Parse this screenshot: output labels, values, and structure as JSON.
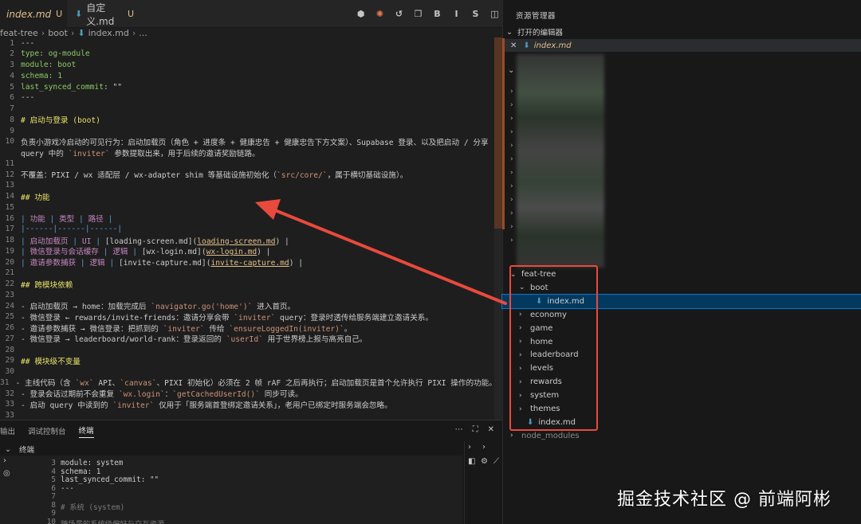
{
  "tabs": [
    {
      "label": "index.md",
      "status": "U"
    },
    {
      "label": "自定义.md",
      "status": "U"
    }
  ],
  "breadcrumb": [
    "feat-tree",
    "boot",
    "index.md",
    "..."
  ],
  "editor_lines": [
    {
      "n": "1",
      "segs": [
        {
          "t": "---",
          "c": "v"
        }
      ]
    },
    {
      "n": "2",
      "segs": [
        {
          "t": "type",
          "c": "yk"
        },
        {
          "t": ": og-module",
          "c": "yk"
        }
      ]
    },
    {
      "n": "3",
      "segs": [
        {
          "t": "module",
          "c": "yk"
        },
        {
          "t": ": boot",
          "c": "yk"
        }
      ]
    },
    {
      "n": "4",
      "segs": [
        {
          "t": "schema",
          "c": "yk"
        },
        {
          "t": ": 1",
          "c": "yk"
        }
      ]
    },
    {
      "n": "5",
      "segs": [
        {
          "t": "last_synced_commit",
          "c": "yk"
        },
        {
          "t": ": \"\"",
          "c": "v"
        }
      ]
    },
    {
      "n": "6",
      "segs": [
        {
          "t": "---",
          "c": "v"
        }
      ]
    },
    {
      "n": "7",
      "segs": []
    },
    {
      "n": "8",
      "segs": [
        {
          "t": "# 启动与登录 (boot)",
          "c": "hd"
        }
      ]
    },
    {
      "n": "9",
      "segs": []
    },
    {
      "n": "10",
      "segs": [
        {
          "t": "负责小游戏冷启动的可见行为：启动加载页（角色 + 进度条 + 健康忠告 + 健康忠告下方文案）、Supabase 登录、以及把启动 / 分享",
          "c": "v"
        }
      ]
    },
    {
      "n": "",
      "segs": [
        {
          "t": "query 中的 ",
          "c": "v"
        },
        {
          "t": "`inviter`",
          "c": "tick"
        },
        {
          "t": " 参数提取出来，用于后续的邀请奖励链路。",
          "c": "v"
        }
      ]
    },
    {
      "n": "11",
      "segs": []
    },
    {
      "n": "12",
      "segs": [
        {
          "t": "不覆盖：PIXI / wx 适配层 / wx-adapter shim 等基础设施初始化（",
          "c": "v"
        },
        {
          "t": "`src/core/`",
          "c": "tick"
        },
        {
          "t": "，属于横切基础设施）。",
          "c": "v"
        }
      ]
    },
    {
      "n": "13",
      "segs": []
    },
    {
      "n": "14",
      "segs": [
        {
          "t": "## 功能",
          "c": "hd"
        }
      ]
    },
    {
      "n": "15",
      "segs": []
    },
    {
      "n": "16",
      "segs": [
        {
          "t": "| ",
          "c": "pipe"
        },
        {
          "t": "功能",
          "c": "mag"
        },
        {
          "t": " | ",
          "c": "pipe"
        },
        {
          "t": "类型",
          "c": "mag"
        },
        {
          "t": " | ",
          "c": "pipe"
        },
        {
          "t": "路径",
          "c": "mag"
        },
        {
          "t": " |",
          "c": "pipe"
        }
      ]
    },
    {
      "n": "17",
      "segs": [
        {
          "t": "|------|------|------|",
          "c": "pipe"
        }
      ]
    },
    {
      "n": "18",
      "segs": [
        {
          "t": "| ",
          "c": "pipe"
        },
        {
          "t": "启动加载页",
          "c": "mag"
        },
        {
          "t": " | ",
          "c": "pipe"
        },
        {
          "t": "UI",
          "c": "mag"
        },
        {
          "t": " | ",
          "c": "pipe"
        },
        {
          "t": "[loading-screen.md](",
          "c": "v"
        },
        {
          "t": "loading-screen.md",
          "c": "und"
        },
        {
          "t": ") |",
          "c": "v"
        }
      ]
    },
    {
      "n": "19",
      "segs": [
        {
          "t": "| ",
          "c": "pipe"
        },
        {
          "t": "微信登录与会话缓存",
          "c": "mag"
        },
        {
          "t": " | ",
          "c": "pipe"
        },
        {
          "t": "逻辑",
          "c": "mag"
        },
        {
          "t": " | ",
          "c": "pipe"
        },
        {
          "t": "[wx-login.md](",
          "c": "v"
        },
        {
          "t": "wx-login.md",
          "c": "und"
        },
        {
          "t": ") |",
          "c": "v"
        }
      ]
    },
    {
      "n": "20",
      "segs": [
        {
          "t": "| ",
          "c": "pipe"
        },
        {
          "t": "邀请参数捕获",
          "c": "mag"
        },
        {
          "t": " | ",
          "c": "pipe"
        },
        {
          "t": "逻辑",
          "c": "mag"
        },
        {
          "t": " | ",
          "c": "pipe"
        },
        {
          "t": "[invite-capture.md](",
          "c": "v"
        },
        {
          "t": "invite-capture.md",
          "c": "und"
        },
        {
          "t": ") |",
          "c": "v"
        }
      ]
    },
    {
      "n": "21",
      "segs": []
    },
    {
      "n": "22",
      "segs": [
        {
          "t": "## 跨模块依赖",
          "c": "hd"
        }
      ]
    },
    {
      "n": "23",
      "segs": []
    },
    {
      "n": "24",
      "segs": [
        {
          "t": "- 启动加载页 → home：加载完成后 ",
          "c": "v"
        },
        {
          "t": "`navigator.go('home')`",
          "c": "tick"
        },
        {
          "t": " 进入首页。",
          "c": "v"
        }
      ]
    },
    {
      "n": "25",
      "segs": [
        {
          "t": "- 微信登录 ← rewards/invite-friends：邀请分享会带 ",
          "c": "v"
        },
        {
          "t": "`inviter`",
          "c": "tick"
        },
        {
          "t": " query：登录时透传给服务端建立邀请关系。",
          "c": "v"
        }
      ]
    },
    {
      "n": "26",
      "segs": [
        {
          "t": "- 邀请参数捕获 → 微信登录：把抓到的 ",
          "c": "v"
        },
        {
          "t": "`inviter`",
          "c": "tick"
        },
        {
          "t": " 传给 ",
          "c": "v"
        },
        {
          "t": "`ensureLoggedIn(inviter)`",
          "c": "tick"
        },
        {
          "t": "。",
          "c": "v"
        }
      ]
    },
    {
      "n": "27",
      "segs": [
        {
          "t": "- 微信登录 → leaderboard/world-rank：登录返回的 ",
          "c": "v"
        },
        {
          "t": "`userId`",
          "c": "tick"
        },
        {
          "t": " 用于世界榜上报与高亮自己。",
          "c": "v"
        }
      ]
    },
    {
      "n": "28",
      "segs": []
    },
    {
      "n": "29",
      "segs": [
        {
          "t": "## 模块级不变量",
          "c": "hd"
        }
      ]
    },
    {
      "n": "30",
      "segs": []
    },
    {
      "n": "31",
      "segs": [
        {
          "t": "- 主线代码（含 ",
          "c": "v"
        },
        {
          "t": "`wx`",
          "c": "tick"
        },
        {
          "t": " API、",
          "c": "v"
        },
        {
          "t": "`canvas`",
          "c": "tick"
        },
        {
          "t": "、PIXI 初始化）必须在 2 帧 rAF 之后再执行；启动加载页是首个允许执行 PIXI 操作的功能。",
          "c": "v"
        }
      ]
    },
    {
      "n": "32",
      "segs": [
        {
          "t": "- 登录会话过期前不会重复 ",
          "c": "v"
        },
        {
          "t": "`wx.login`",
          "c": "tick"
        },
        {
          "t": "：",
          "c": "v"
        },
        {
          "t": "`getCachedUserId()`",
          "c": "tick"
        },
        {
          "t": " 同步可读。",
          "c": "v"
        }
      ]
    },
    {
      "n": "33",
      "segs": [
        {
          "t": "- 启动 query 中读到的 ",
          "c": "v"
        },
        {
          "t": "`inviter`",
          "c": "tick"
        },
        {
          "t": " 仅用于「服务端首登绑定邀请关系」，老用户已绑定时服务端会忽略。",
          "c": "v"
        }
      ]
    },
    {
      "n": "33",
      "segs": []
    }
  ],
  "panel": {
    "tabs": [
      "输出",
      "调试控制台",
      "终端"
    ],
    "terminal_title": "终端",
    "lines": [
      {
        "n": "3",
        "t": "module: system"
      },
      {
        "n": "4",
        "t": "schema: 1"
      },
      {
        "n": "5",
        "t": "last_synced_commit: \"\""
      },
      {
        "n": "6",
        "t": "---"
      },
      {
        "n": "7",
        "t": ""
      },
      {
        "n": "8",
        "t": "# 系统 (system)"
      },
      {
        "n": "9",
        "t": ""
      },
      {
        "n": "10",
        "t": "跨场景的系统级偏好与交互资源"
      }
    ]
  },
  "explorer": {
    "title": "资源管理器",
    "open_editors": "打开的编辑器",
    "open_file": "index.md",
    "tree": [
      {
        "label": "feat-tree",
        "depth": 0,
        "chev": "⌄",
        "md": false,
        "sel": false,
        "dim": false
      },
      {
        "label": "boot",
        "depth": 1,
        "chev": "⌄",
        "md": false,
        "sel": false,
        "dim": false
      },
      {
        "label": "index.md",
        "depth": 2,
        "chev": "",
        "md": true,
        "sel": true,
        "dim": false
      },
      {
        "label": "economy",
        "depth": 1,
        "chev": "›",
        "md": false,
        "sel": false,
        "dim": false
      },
      {
        "label": "game",
        "depth": 1,
        "chev": "›",
        "md": false,
        "sel": false,
        "dim": false
      },
      {
        "label": "home",
        "depth": 1,
        "chev": "›",
        "md": false,
        "sel": false,
        "dim": false
      },
      {
        "label": "leaderboard",
        "depth": 1,
        "chev": "›",
        "md": false,
        "sel": false,
        "dim": false
      },
      {
        "label": "levels",
        "depth": 1,
        "chev": "›",
        "md": false,
        "sel": false,
        "dim": false
      },
      {
        "label": "rewards",
        "depth": 1,
        "chev": "›",
        "md": false,
        "sel": false,
        "dim": false
      },
      {
        "label": "system",
        "depth": 1,
        "chev": "›",
        "md": false,
        "sel": false,
        "dim": false
      },
      {
        "label": "themes",
        "depth": 1,
        "chev": "›",
        "md": false,
        "sel": false,
        "dim": false
      },
      {
        "label": "index.md",
        "depth": 1,
        "chev": "",
        "md": true,
        "sel": false,
        "dim": false
      },
      {
        "label": "node_modules",
        "depth": 0,
        "chev": "›",
        "md": false,
        "sel": false,
        "dim": true
      }
    ]
  },
  "watermark": "掘金技术社区 @ 前端阿彬",
  "colors": {
    "accent": "#0078d4",
    "annotation": "#e84a3d"
  }
}
